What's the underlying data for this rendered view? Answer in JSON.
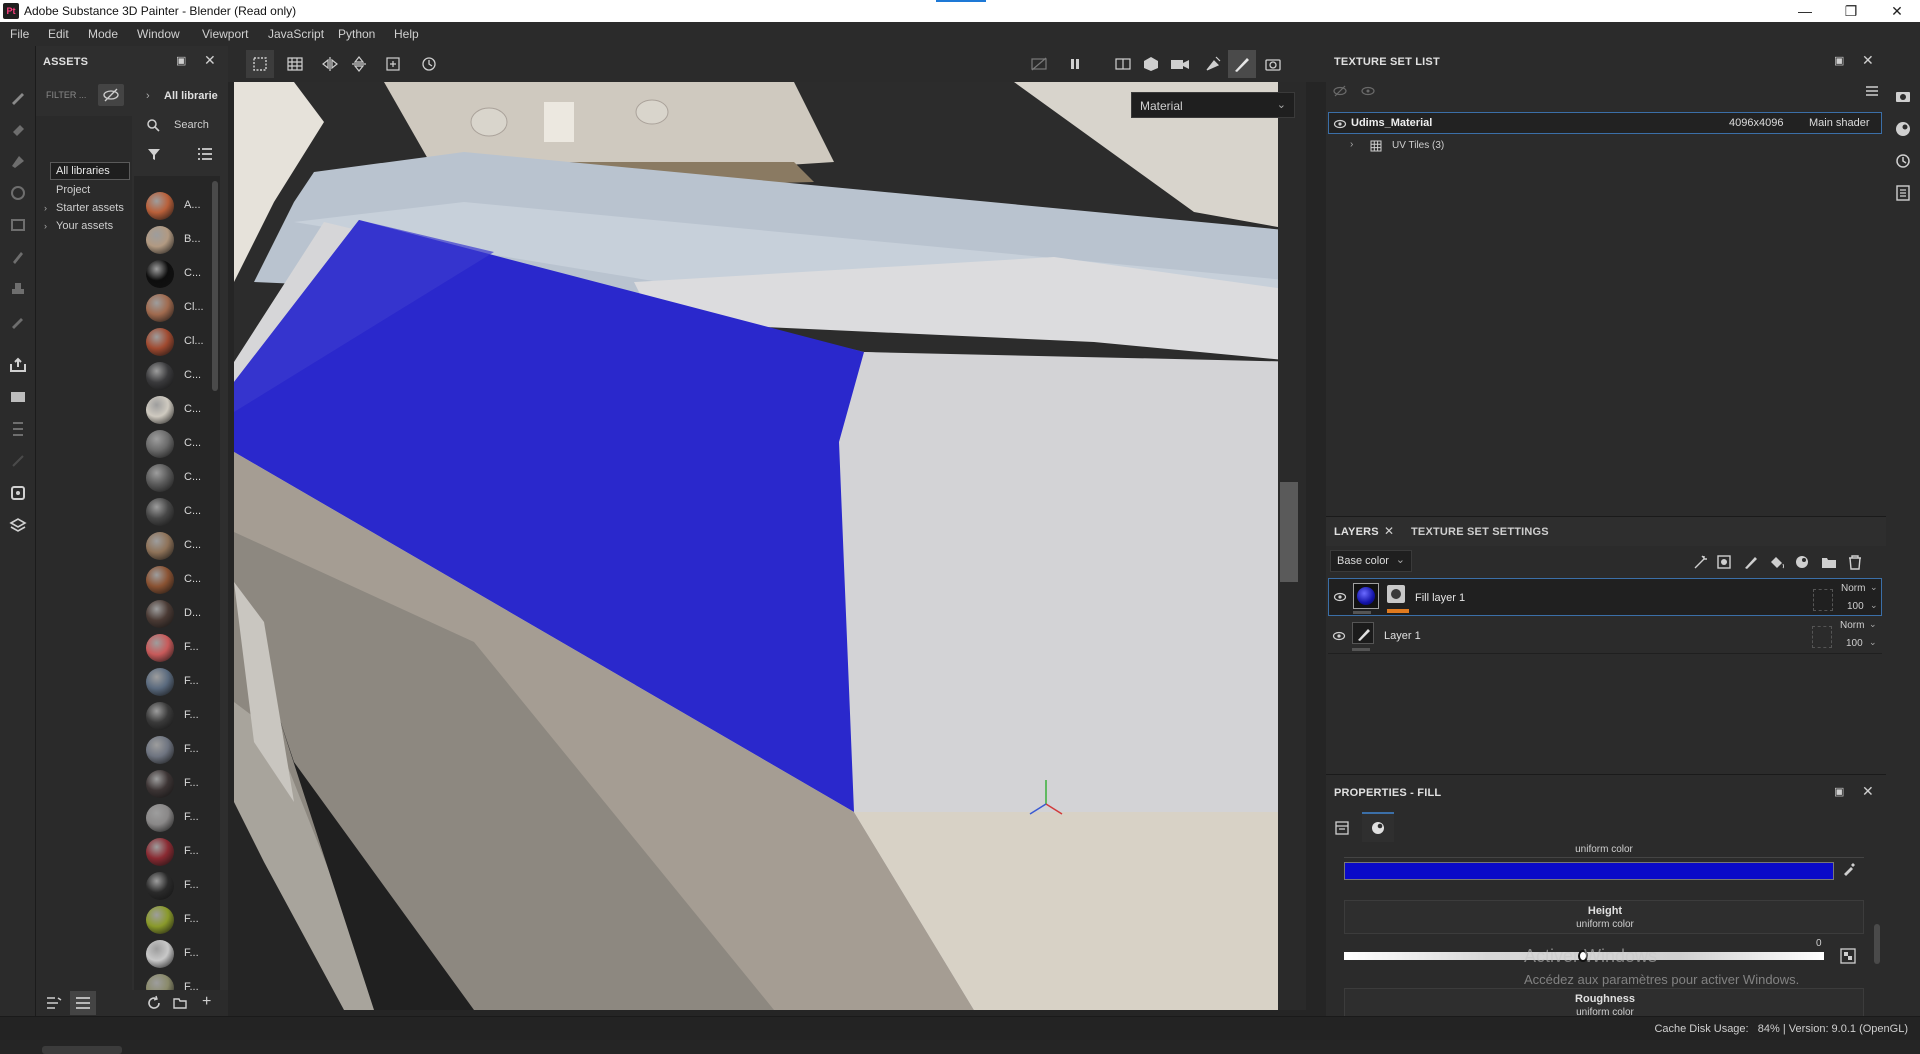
{
  "window": {
    "title": "Adobe Substance 3D Painter - Blender (Read only)",
    "app_icon": "Pt"
  },
  "menu": [
    "File",
    "Edit",
    "Mode",
    "Window",
    "Viewport",
    "JavaScript",
    "Python",
    "Help"
  ],
  "assets": {
    "title": "ASSETS",
    "filter_label": "FILTER ...",
    "tree": [
      "All libraries",
      "Project",
      "Starter assets",
      "Your assets"
    ],
    "breadcrumb": "All librarie",
    "search_placeholder": "Search",
    "items": [
      {
        "label": "A...",
        "color": "#b9603a"
      },
      {
        "label": "B...",
        "color": "#b29a82"
      },
      {
        "label": "C...",
        "color": "#0e0e0e"
      },
      {
        "label": "Cl...",
        "color": "#a06a4e"
      },
      {
        "label": "Cl...",
        "color": "#a04a30"
      },
      {
        "label": "C...",
        "color": "#3a3a3c"
      },
      {
        "label": "C...",
        "color": "#cfcac0"
      },
      {
        "label": "C...",
        "color": "#6b6b6b"
      },
      {
        "label": "C...",
        "color": "#5a5a5a"
      },
      {
        "label": "C...",
        "color": "#474747"
      },
      {
        "label": "C...",
        "color": "#8e7258"
      },
      {
        "label": "C...",
        "color": "#8a5232"
      },
      {
        "label": "D...",
        "color": "#4a3a34"
      },
      {
        "label": "F...",
        "color": "#c85a5a"
      },
      {
        "label": "F...",
        "color": "#5a6a7e"
      },
      {
        "label": "F...",
        "color": "#3a3a3a"
      },
      {
        "label": "F...",
        "color": "#6e7480"
      },
      {
        "label": "F...",
        "color": "#3c3434"
      },
      {
        "label": "F...",
        "color": "#8a8888"
      },
      {
        "label": "F...",
        "color": "#8a2a32"
      },
      {
        "label": "F...",
        "color": "#2a2a2a"
      },
      {
        "label": "F...",
        "color": "#8a9a2a"
      },
      {
        "label": "F...",
        "color": "#c8c8c8"
      },
      {
        "label": "F...",
        "color": "#8a8a6a"
      }
    ]
  },
  "viewport": {
    "shading_mode": "Material"
  },
  "texture_set_list": {
    "title": "TEXTURE SET LIST",
    "material": {
      "name": "Udims_Material",
      "resolution": "4096x4096",
      "shader": "Main shader"
    },
    "uv_tiles": "UV Tiles (3)"
  },
  "layers": {
    "tab_layers": "LAYERS",
    "tab_settings": "TEXTURE SET SETTINGS",
    "channel": "Base color",
    "rows": [
      {
        "name": "Fill layer 1",
        "blend": "Norm",
        "opacity": "100"
      },
      {
        "name": "Layer 1",
        "blend": "Norm",
        "opacity": "100"
      }
    ]
  },
  "properties": {
    "title": "PROPERTIES - FILL",
    "base_color_mode": "uniform color",
    "base_color": "#0a0ac8",
    "height_title": "Height",
    "height_mode": "uniform color",
    "height_value": "0",
    "roughness_title": "Roughness",
    "roughness_mode": "uniform color"
  },
  "watermark": {
    "line1": "Activer Windows",
    "line2": "Accédez aux paramètres pour activer Windows."
  },
  "status": {
    "text": "Cache Disk Usage:   84% | Version: 9.0.1 (OpenGL)"
  }
}
